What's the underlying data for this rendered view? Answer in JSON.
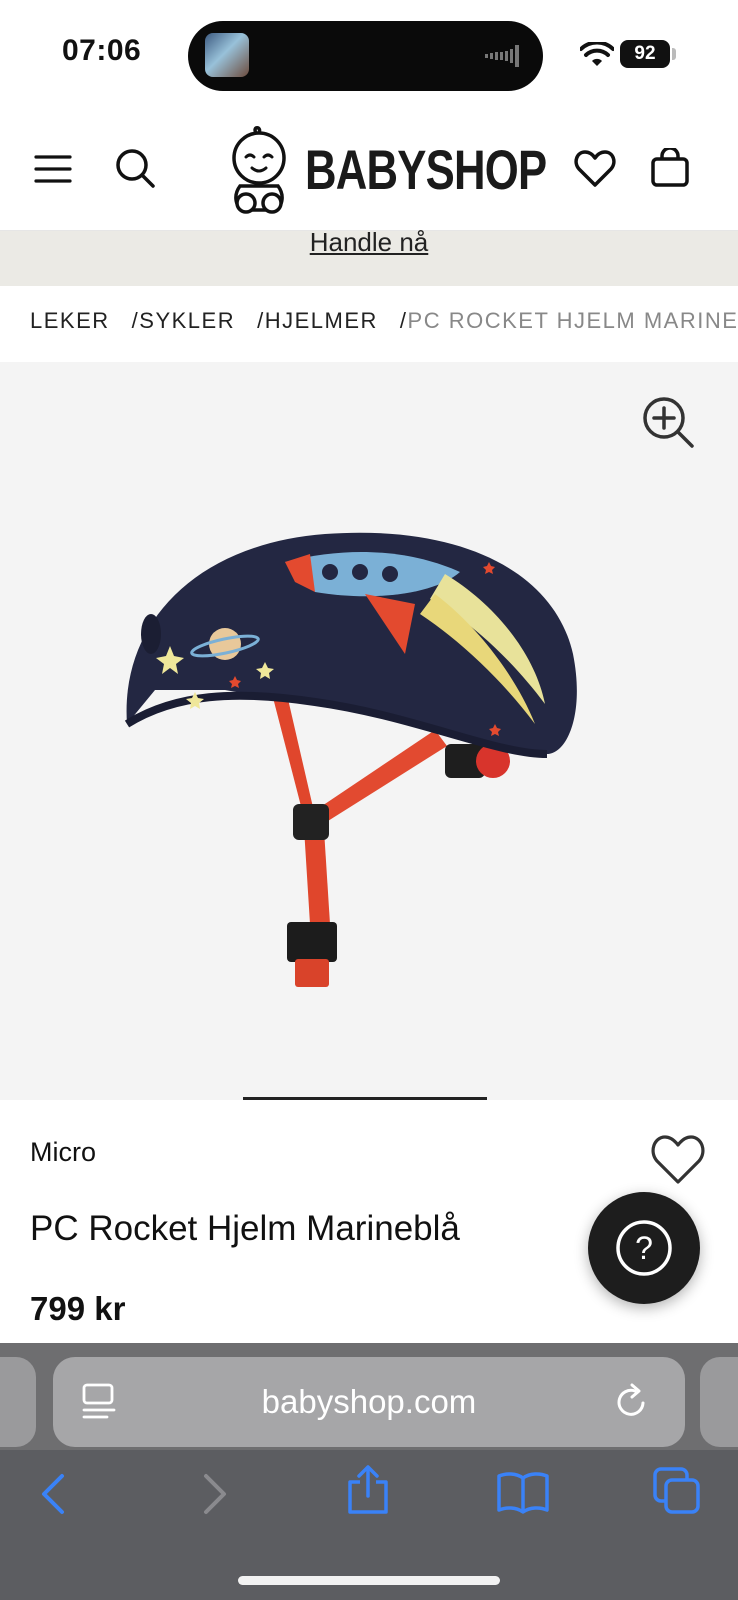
{
  "status_bar": {
    "time": "07:06",
    "battery": "92"
  },
  "header": {
    "menu_icon": "hamburger-menu-icon",
    "search_icon": "search-icon",
    "logo_text": "BABYSHOP",
    "wishlist_icon": "heart-icon",
    "cart_icon": "shopping-bag-icon"
  },
  "promo": {
    "link": "Handle nå"
  },
  "breadcrumb": {
    "items": [
      "LEKER",
      "SYKLER",
      "HJELMER"
    ],
    "separator": "/",
    "current": "PC ROCKET HJELM MARINEBLÅ"
  },
  "gallery": {
    "zoom_icon": "zoom-in-icon",
    "image_alt": "PC Rocket Hjelm Marineblå"
  },
  "product": {
    "brand": "Micro",
    "title": "PC Rocket Hjelm Marineblå",
    "price": "799 kr"
  },
  "help": {
    "icon": "question-mark-icon",
    "label": "?"
  },
  "browser": {
    "url": "babyshop.com",
    "reader_icon": "reader-icon",
    "reload_icon": "reload-icon",
    "back_icon": "back-chevron-icon",
    "forward_icon": "forward-chevron-icon",
    "share_icon": "share-icon",
    "bookmarks_icon": "book-icon",
    "tabs_icon": "tabs-icon",
    "accent": "#3a82f7"
  }
}
